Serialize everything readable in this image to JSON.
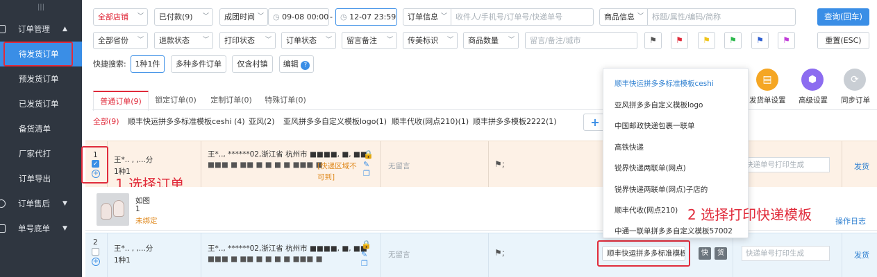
{
  "sidebar": {
    "grip": "|||",
    "groups": [
      {
        "label": "订单管理",
        "arrow": "▲"
      },
      {
        "label": "订单售后",
        "arrow": "▼"
      },
      {
        "label": "单号底单",
        "arrow": "▼"
      }
    ],
    "items": [
      "待发货订单",
      "预发货订单",
      "已发货订单",
      "备货清单",
      "厂家代打",
      "订单导出"
    ]
  },
  "filters": {
    "shop": "全部店铺",
    "payment": "已付款(9)",
    "time_type": "成团时间",
    "date_from": "09-08 00:00",
    "date_sep": "-",
    "date_to": "12-07 23:59",
    "order_info_label": "订单信息",
    "order_info_placeholder": "收件人/手机号/订单号/快递单号",
    "product_info_label": "商品信息",
    "product_info_placeholder": "标题/属性/编码/简称",
    "province": "全部省份",
    "refund": "退款状态",
    "print_status": "打印状态",
    "order_status": "订单状态",
    "remark": "留言备注",
    "mark": "传美标识",
    "qty": "商品数量",
    "remark_search_placeholder": "留言/备注/城市",
    "query_button": "查询(回车)",
    "reset_button": "重置(ESC)",
    "flag_colors": [
      "#555555",
      "#e02b3b",
      "#f0c419",
      "#2db84d",
      "#2f5fd1",
      "#c03bd8"
    ]
  },
  "quick": {
    "label": "快捷搜索:",
    "options": [
      "1种1件",
      "多种多件订单",
      "仅含村镇"
    ],
    "edit": "编辑",
    "help": "?"
  },
  "tools": {
    "add_btn": "+",
    "items": [
      {
        "label": "发货单设置",
        "color": "#f5a623",
        "icon": "▤"
      },
      {
        "label": "高级设置",
        "color": "#8c6cf0",
        "icon": "⬢"
      },
      {
        "label": "同步订单",
        "color": "#c9ced4",
        "icon": "⟳"
      }
    ]
  },
  "tabs": [
    "普通订单(9)",
    "锁定订单(0)",
    "定制订单(0)",
    "特殊订单(0)"
  ],
  "subfilters": [
    "全部(9)",
    "顺丰快运拼多多标准模板ceshi (4)",
    "亚风(2)",
    "亚风拼多多自定义模板logo(1)",
    "顺丰代收(网点210)(1)",
    "顺丰拼多多模板2222(1)"
  ],
  "orders": [
    {
      "index": "1",
      "checked": "✓",
      "plus": "+",
      "buyer": "王*.. ,  ,...分",
      "count": "1种1",
      "addr1": "王*.., ******02,浙江省 杭州市 ■■■■, ■, ■■",
      "addr2": "■■■ ■ ■■ ■ ■ ■ ■ ■■■ ■",
      "warning": "[快递区域不可到]",
      "remark": "无留言",
      "flag": "⚑;",
      "tracking_placeholder": "快递单号打印生成",
      "ship": "发货",
      "product_name": "如图",
      "product_qty": "1",
      "product_status": "未绑定",
      "log": "操作日志"
    },
    {
      "index": "2",
      "plus": "+",
      "buyer": "王*.. ,  ,...分",
      "count": "1种1",
      "addr1": "王*.., ******02,浙江省 杭州市 ■■■■, ■, ■■",
      "addr2": "■■■ ■ ■■ ■ ■ ■ ■ ■■■ ■",
      "remark": "无留言",
      "flag": "⚑;",
      "template_select": "顺丰快运拼多多标准模板",
      "btn_kuai": "快",
      "btn_huo": "货",
      "tracking_placeholder": "快递单号打印生成",
      "ship": "发货"
    }
  ],
  "template_menu": [
    "顺丰快运拼多多标准模板ceshi",
    "亚风拼多多自定义模板logo",
    "中国邮政快递包裹一联单",
    "高铁快递",
    "锐界快递两联单(网点)",
    "锐界快递两联单(网点)子店的",
    "顺丰代收(网点210)",
    "中通一联单拼多多自定义模板57002"
  ],
  "annotations": {
    "step1": "1 选择订单",
    "step2": "2 选择打印快递模板"
  }
}
